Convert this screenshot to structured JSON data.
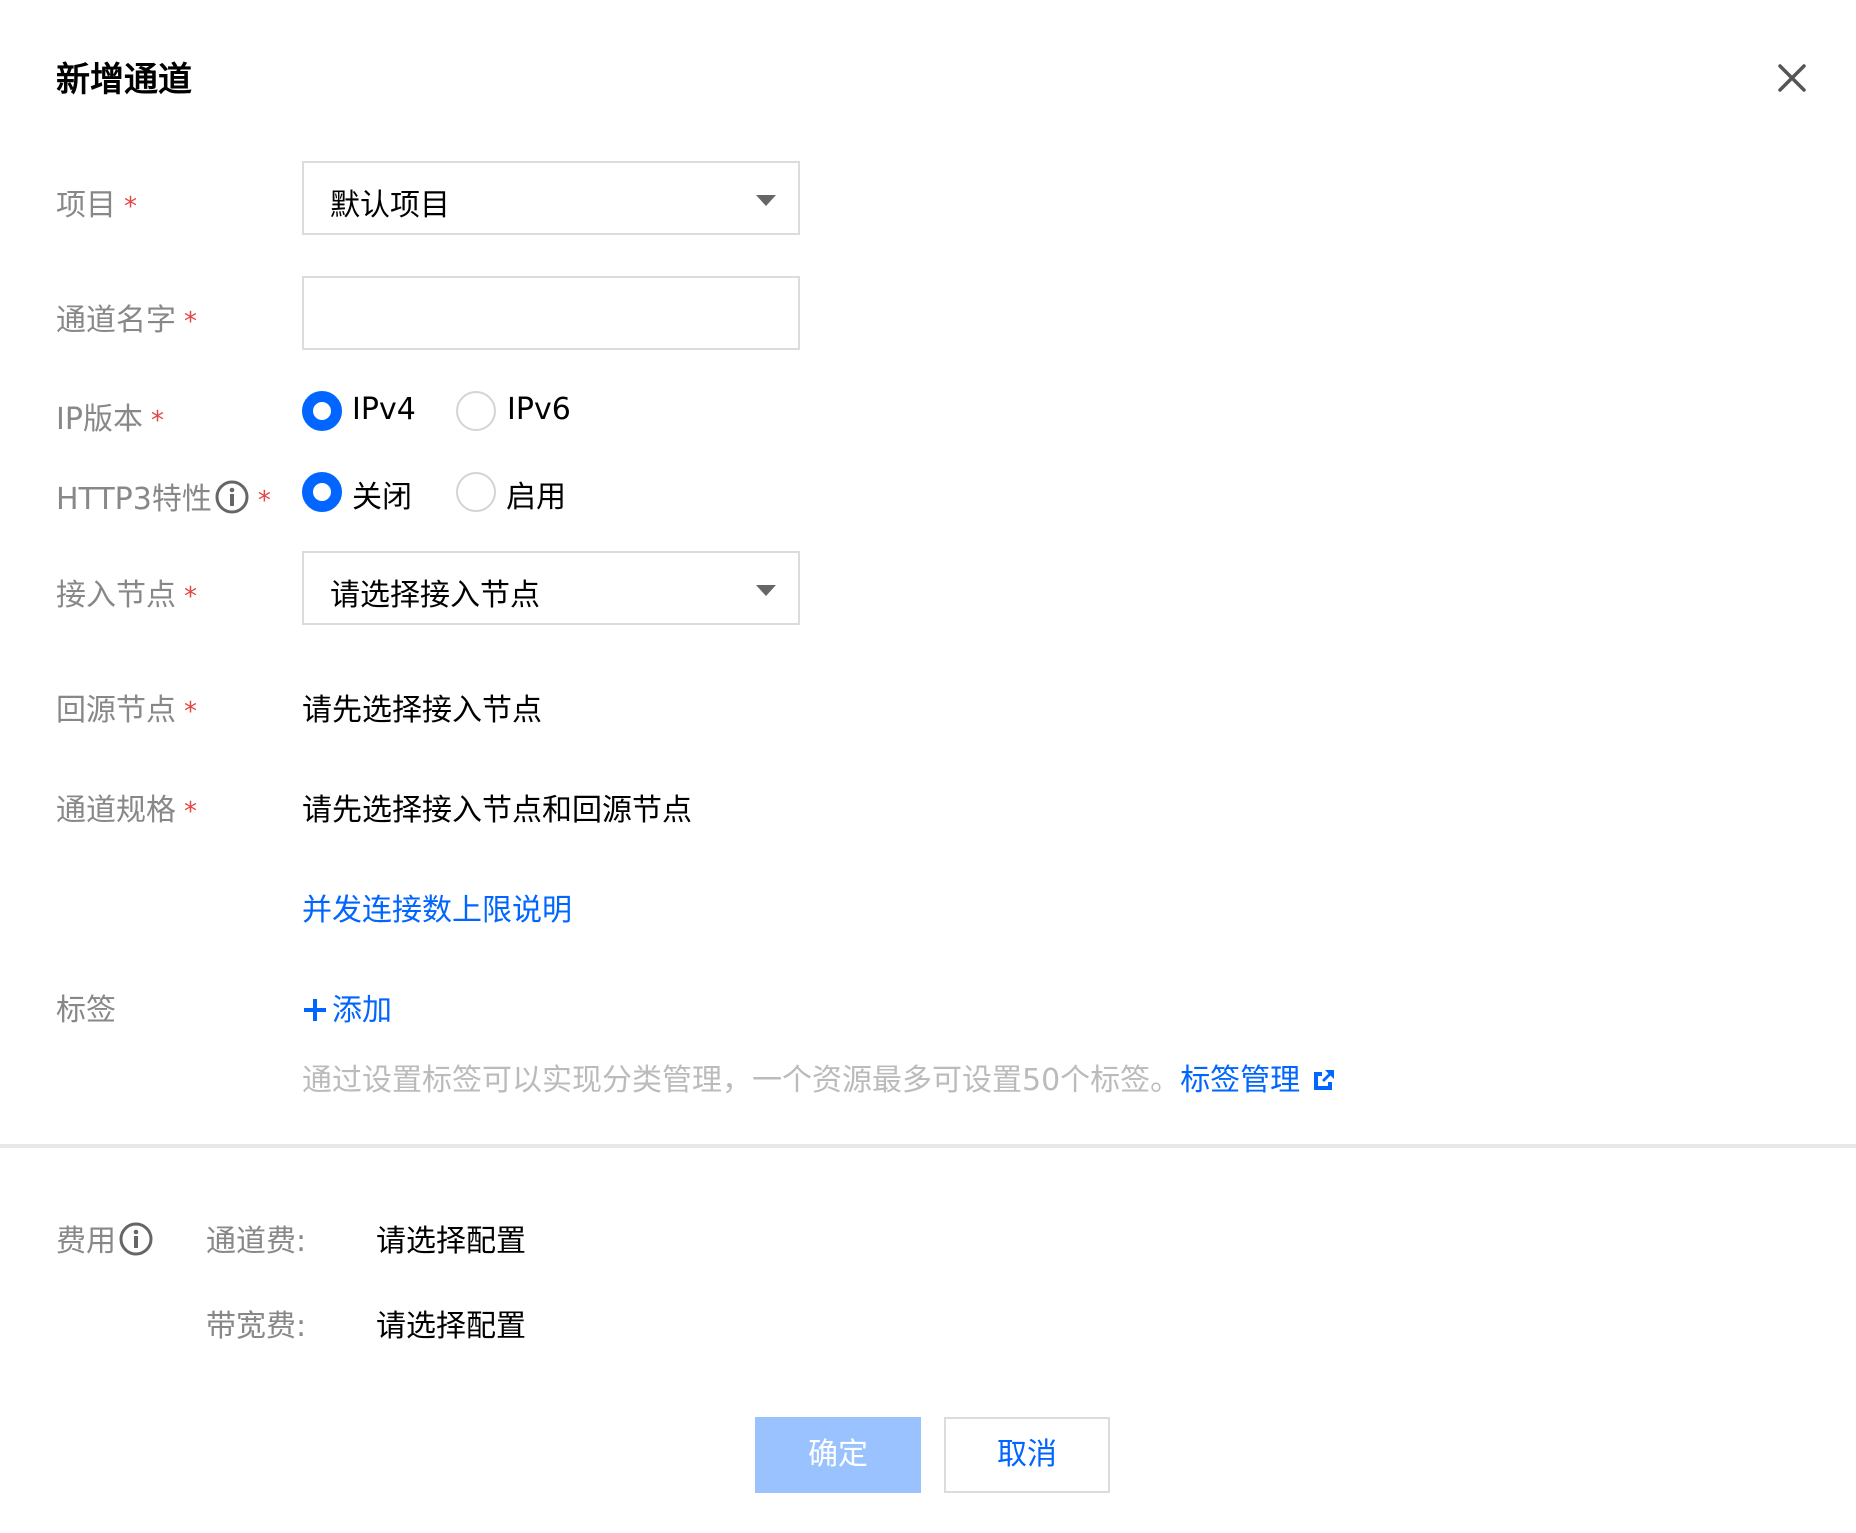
{
  "dialog": {
    "title": "新增通道"
  },
  "form": {
    "project": {
      "label": "项目",
      "required_mark": "*",
      "selected": "默认项目"
    },
    "channel_name": {
      "label": "通道名字",
      "required_mark": "*",
      "value": "",
      "placeholder": ""
    },
    "ip_version": {
      "label": "IP版本",
      "required_mark": "*",
      "options": [
        "IPv4",
        "IPv6"
      ],
      "selected": "IPv4"
    },
    "http3": {
      "label": "HTTP3特性",
      "required_mark": "*",
      "options": [
        "关闭",
        "启用"
      ],
      "selected": "关闭"
    },
    "access_node": {
      "label": "接入节点",
      "required_mark": "*",
      "placeholder": "请选择接入节点"
    },
    "origin_node": {
      "label": "回源节点",
      "required_mark": "*",
      "value": "请先选择接入节点"
    },
    "channel_spec": {
      "label": "通道规格",
      "required_mark": "*",
      "value": "请先选择接入节点和回源节点"
    },
    "concurrency_link": "并发连接数上限说明",
    "tags": {
      "label": "标签",
      "add_label": "添加",
      "hint": "通过设置标签可以实现分类管理，一个资源最多可设置50个标签。",
      "manage_link": "标签管理"
    }
  },
  "cost": {
    "label": "费用",
    "channel_fee": {
      "label": "通道费:",
      "value": "请选择配置"
    },
    "bandwidth_fee": {
      "label": "带宽费:",
      "value": "请选择配置"
    }
  },
  "footer": {
    "confirm_label": "确定",
    "cancel_label": "取消"
  },
  "colors": {
    "primary": "#0066ff",
    "required": "#e54545",
    "label": "#888888",
    "hint": "#bbbbbb",
    "disabled_primary": "#99c2ff"
  }
}
